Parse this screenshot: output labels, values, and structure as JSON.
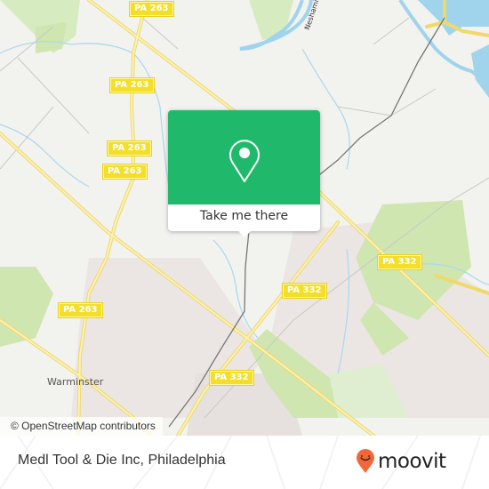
{
  "map": {
    "road_shields": [
      {
        "label": "PA 263",
        "id": "pa263-top"
      },
      {
        "label": "PA 263",
        "id": "pa263-upper"
      },
      {
        "label": "PA 263",
        "id": "pa263-middle"
      },
      {
        "label": "PA 263",
        "id": "pa263-lower-mid"
      },
      {
        "label": "PA 263",
        "id": "pa263-lower"
      },
      {
        "label": "PA 332",
        "id": "pa332-east"
      },
      {
        "label": "PA 332",
        "id": "pa332-center"
      },
      {
        "label": "PA 332",
        "id": "pa332-south"
      }
    ],
    "places": {
      "town": "Warminster",
      "river": "Neshaminy"
    },
    "attribution": "© OpenStreetMap contributors",
    "colors": {
      "land": "#f2f2ef",
      "park": "#cfe6b0",
      "urban": "#ebe6e4",
      "water": "#9fd4ec",
      "road": "#f5e27a"
    }
  },
  "popup": {
    "button_label": "Take me there",
    "icon": "map-pin-icon",
    "color": "#20b96b"
  },
  "footer": {
    "place_name": "Medl Tool & Die Inc, Philadelphia",
    "logo_text": "moovit",
    "logo_color": "#f26739"
  }
}
